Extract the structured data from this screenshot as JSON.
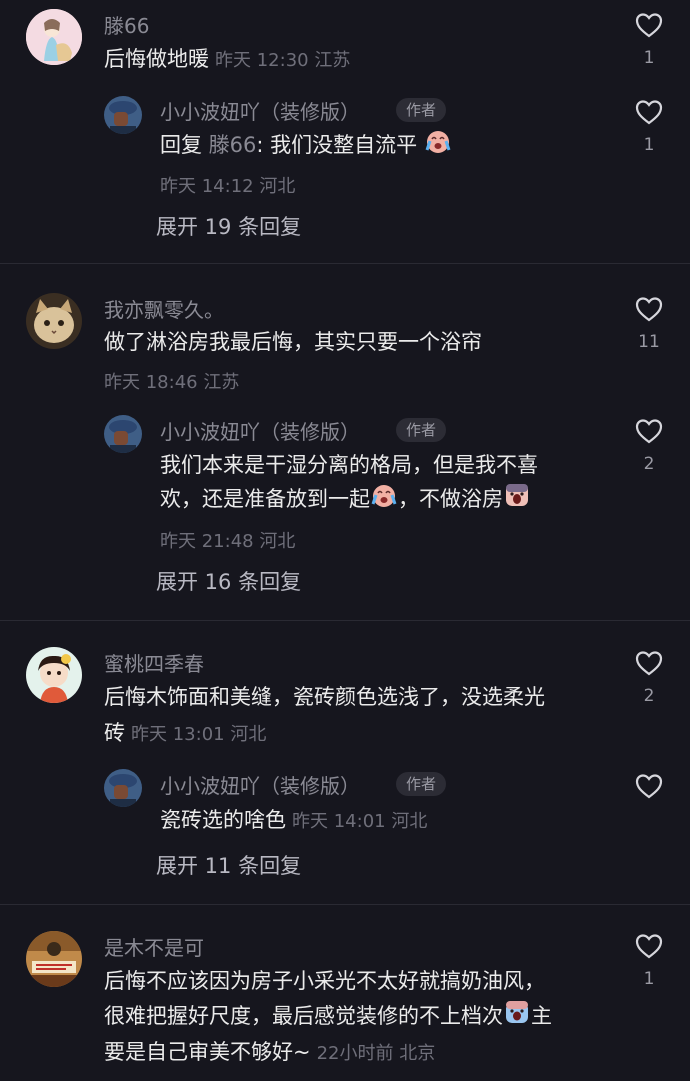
{
  "comments": [
    {
      "user": "滕66",
      "text": "后悔做地暖",
      "time": "昨天 12:30 江苏",
      "likes": "1",
      "reply": {
        "user": "小小波妞吖（装修版）",
        "badge": "作者",
        "prefix": "回复",
        "target": "滕66",
        "text": ": 我们没整自流平",
        "time": "昨天 14:12 河北",
        "likes": "1"
      },
      "expand": "展开 19 条回复"
    },
    {
      "user": "我亦飘零久。",
      "text": "做了淋浴房我最后悔，其实只要一个浴帘",
      "time": "昨天 18:46 江苏",
      "likes": "11",
      "reply": {
        "user": "小小波妞吖（装修版）",
        "badge": "作者",
        "text_line1": "我们本来是干湿分离的格局，但是我不喜",
        "text_line2a": "欢，还是准备放到一起",
        "text_line2b": "，不做浴房",
        "time": "昨天 21:48 河北",
        "likes": "2"
      },
      "expand": "展开 16 条回复"
    },
    {
      "user": "蜜桃四季春",
      "text_line1": "后悔木饰面和美缝，瓷砖颜色选浅了，没选柔光",
      "text_line2": "砖",
      "time": "昨天 13:01 河北",
      "likes": "2",
      "reply": {
        "user": "小小波妞吖（装修版）",
        "badge": "作者",
        "text": "瓷砖选的啥色",
        "time": "昨天 14:01 河北",
        "likes": ""
      },
      "expand": "展开 11 条回复"
    },
    {
      "user": "是木不是可",
      "text_line1": "后悔不应该因为房子小采光不太好就搞奶油风，",
      "text_line2": "很难把握好尺度，最后感觉装修的不上档次",
      "text_line2b": "主",
      "text_line3": "要是自己审美不够好~",
      "time": "22小时前 北京",
      "likes": "1"
    }
  ],
  "colors": {
    "background": "#16161e",
    "name": "#8a8a94",
    "text": "#ebebeb",
    "meta": "#6f6f7a"
  },
  "icons": [
    "heart-outline-icon",
    "crying-face-emoji",
    "screaming-face-emoji"
  ]
}
